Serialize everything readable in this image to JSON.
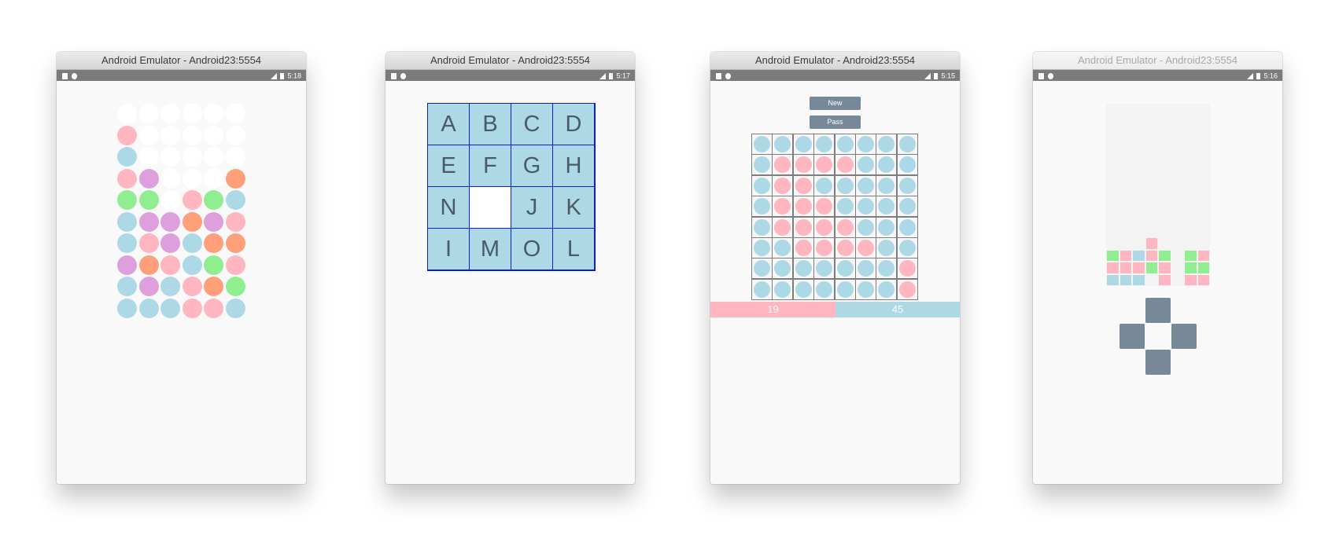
{
  "window_title": "Android Emulator - Android23:5554",
  "colors": {
    "white": "#ffffff",
    "pink": "#ffb6c1",
    "blue": "#add8e6",
    "plum": "#dda0dd",
    "green": "#90ee90",
    "orange": "#ffa07a",
    "slate": "#778899"
  },
  "screens": [
    {
      "title": "Android Emulator - Android23:5554",
      "time": "5:18",
      "app": "bubbles",
      "grid": [
        [
          "W",
          "W",
          "W",
          "W",
          "W",
          "W"
        ],
        [
          "P",
          "W",
          "W",
          "W",
          "W",
          "W"
        ],
        [
          "B",
          "W",
          "W",
          "W",
          "W",
          "W"
        ],
        [
          "P",
          "M",
          "W",
          "W",
          "W",
          "O"
        ],
        [
          "G",
          "G",
          "W",
          "P",
          "G",
          "B"
        ],
        [
          "B",
          "M",
          "M",
          "O",
          "M",
          "P"
        ],
        [
          "B",
          "P",
          "M",
          "B",
          "O",
          "O"
        ],
        [
          "M",
          "O",
          "P",
          "B",
          "G",
          "P"
        ],
        [
          "B",
          "M",
          "B",
          "P",
          "O",
          "G"
        ],
        [
          "B",
          "B",
          "B",
          "P",
          "P",
          "B"
        ]
      ]
    },
    {
      "title": "Android Emulator - Android23:5554",
      "time": "5:17",
      "app": "puzzle",
      "tiles": [
        [
          "A",
          "B",
          "C",
          "D"
        ],
        [
          "E",
          "F",
          "G",
          "H"
        ],
        [
          "N",
          "",
          "J",
          "K"
        ],
        [
          "I",
          "M",
          "O",
          "L"
        ]
      ]
    },
    {
      "title": "Android Emulator - Android23:5554",
      "time": "5:15",
      "app": "reversi",
      "new_label": "New",
      "pass_label": "Pass",
      "board": [
        [
          "B",
          "B",
          "B",
          "B",
          "B",
          "B",
          "B",
          "B"
        ],
        [
          "B",
          "P",
          "P",
          "P",
          "P",
          "B",
          "B",
          "B"
        ],
        [
          "B",
          "P",
          "P",
          "B",
          "B",
          "B",
          "B",
          "B"
        ],
        [
          "B",
          "P",
          "P",
          "P",
          "B",
          "B",
          "B",
          "B"
        ],
        [
          "B",
          "P",
          "P",
          "P",
          "P",
          "B",
          "B",
          "B"
        ],
        [
          "B",
          "B",
          "P",
          "P",
          "P",
          "P",
          "B",
          "B"
        ],
        [
          "B",
          "B",
          "B",
          "B",
          "B",
          "B",
          "B",
          "P"
        ],
        [
          "B",
          "B",
          "B",
          "B",
          "B",
          "B",
          "B",
          "P"
        ]
      ],
      "score_pink": "19",
      "score_blue": "45",
      "score_pink_fraction": 0.5
    },
    {
      "title": "Android Emulator - Android23:5554",
      "time": "5:16",
      "app": "tetris",
      "rows": 15,
      "cols": 8,
      "filled": [
        [
          11,
          3,
          "P"
        ],
        [
          12,
          0,
          "G"
        ],
        [
          12,
          1,
          "P"
        ],
        [
          12,
          2,
          "B"
        ],
        [
          12,
          3,
          "P"
        ],
        [
          12,
          4,
          "G"
        ],
        [
          12,
          6,
          "G"
        ],
        [
          12,
          7,
          "P"
        ],
        [
          13,
          0,
          "P"
        ],
        [
          13,
          1,
          "P"
        ],
        [
          13,
          2,
          "P"
        ],
        [
          13,
          3,
          "G"
        ],
        [
          13,
          4,
          "P"
        ],
        [
          13,
          6,
          "G"
        ],
        [
          13,
          7,
          "G"
        ],
        [
          14,
          0,
          "B"
        ],
        [
          14,
          1,
          "B"
        ],
        [
          14,
          2,
          "B"
        ],
        [
          14,
          4,
          "P"
        ],
        [
          14,
          6,
          "P"
        ],
        [
          14,
          7,
          "P"
        ]
      ]
    }
  ]
}
